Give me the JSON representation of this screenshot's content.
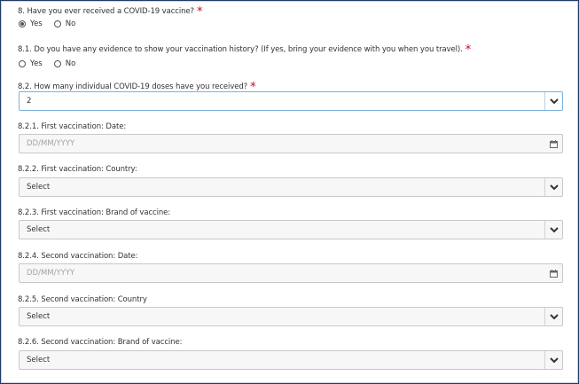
{
  "q8": {
    "label": "8. Have you ever received a COVID-19 vaccine?",
    "required_mark": "*",
    "options": [
      {
        "label": "Yes",
        "checked": true
      },
      {
        "label": "No",
        "checked": false
      }
    ]
  },
  "q81": {
    "label": "8.1. Do you have any evidence to show your vaccination history? (If yes, bring your evidence with you when you travel).",
    "required_mark": "*",
    "options": [
      {
        "label": "Yes",
        "checked": false
      },
      {
        "label": "No",
        "checked": false
      }
    ]
  },
  "q82": {
    "label": "8.2. How many individual COVID-19 doses have you received?",
    "required_mark": "*",
    "value": "2"
  },
  "q821": {
    "label": "8.2.1. First vaccination: Date:",
    "placeholder": "DD/MM/YYYY"
  },
  "q822": {
    "label": "8.2.2. First vaccination: Country:",
    "value": "Select"
  },
  "q823": {
    "label": "8.2.3. First vaccination: Brand of vaccine:",
    "value": "Select"
  },
  "q824": {
    "label": "8.2.4. Second vaccination: Date:",
    "placeholder": "DD/MM/YYYY"
  },
  "q825": {
    "label": "8.2.5. Second vaccination: Country",
    "value": "Select"
  },
  "q826": {
    "label": "8.2.6. Second vaccination: Brand of vaccine:",
    "value": "Select"
  },
  "icons": {
    "dropdown": "chevron-down-icon",
    "date": "calendar-icon",
    "radio": "radio-button"
  },
  "colors": {
    "required": "#d0021b",
    "focus_border": "#7ab1e0",
    "text": "#333333",
    "placeholder": "#a3a3a3",
    "frame": "#1f3a66"
  }
}
